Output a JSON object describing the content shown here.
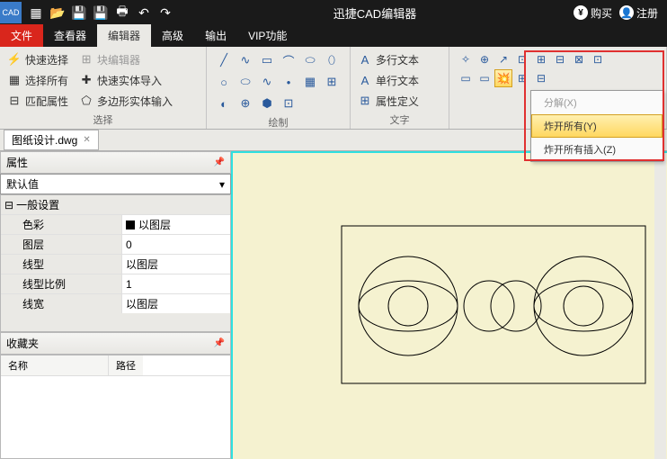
{
  "titlebar": {
    "app_title": "迅捷CAD编辑器",
    "buy": "购买",
    "register": "注册"
  },
  "tabs": {
    "file": "文件",
    "viewer": "查看器",
    "editor": "编辑器",
    "advanced": "高级",
    "output": "输出",
    "vip": "VIP功能"
  },
  "ribbon": {
    "select": {
      "quick_select": "快速选择",
      "select_all": "选择所有",
      "match_props": "匹配属性",
      "block_editor": "块编辑器",
      "quick_entity_import": "快速实体导入",
      "poly_entity_import": "多边形实体输入",
      "label": "选择"
    },
    "draw": {
      "label": "绘制"
    },
    "text": {
      "multiline": "多行文本",
      "singleline": "单行文本",
      "attrdef": "属性定义",
      "label": "文字"
    }
  },
  "dropdown": {
    "explode": "分解(X)",
    "explode_all": "炸开所有(Y)",
    "explode_all_insert": "炸开所有插入(Z)"
  },
  "file_tab": "图纸设计.dwg",
  "panels": {
    "properties": "属性",
    "default": "默认值",
    "general": "一般设置",
    "color_k": "色彩",
    "color_v": "以图层",
    "layer_k": "图层",
    "layer_v": "0",
    "linetype_k": "线型",
    "linetype_v": "以图层",
    "ltscale_k": "线型比例",
    "ltscale_v": "1",
    "lineweight_k": "线宽",
    "lineweight_v": "以图层",
    "favorites": "收藏夹",
    "name_col": "名称",
    "path_col": "路径"
  }
}
